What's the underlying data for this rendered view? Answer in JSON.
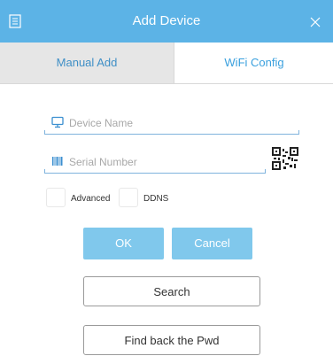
{
  "header": {
    "title": "Add Device",
    "left_icon": "document-icon",
    "right_icon": "close-icon"
  },
  "tabs": [
    {
      "label": "Manual Add",
      "selected": true
    },
    {
      "label": "WiFi Config",
      "selected": false
    }
  ],
  "form": {
    "device_name": {
      "value": "",
      "placeholder": "Device Name",
      "icon": "monitor-icon"
    },
    "serial_number": {
      "value": "",
      "placeholder": "Serial Number",
      "icon": "barcode-icon",
      "scan_icon": "qr-code-icon"
    },
    "options": [
      {
        "label": "Advanced",
        "checked": false
      },
      {
        "label": "DDNS",
        "checked": false
      }
    ]
  },
  "buttons": {
    "ok": "OK",
    "cancel": "Cancel",
    "search": "Search",
    "find_pwd": "Find back the Pwd"
  },
  "colors": {
    "accent": "#5cb3e6",
    "button": "#80c8ec",
    "tab_selected_bg": "#e6e6e6"
  }
}
